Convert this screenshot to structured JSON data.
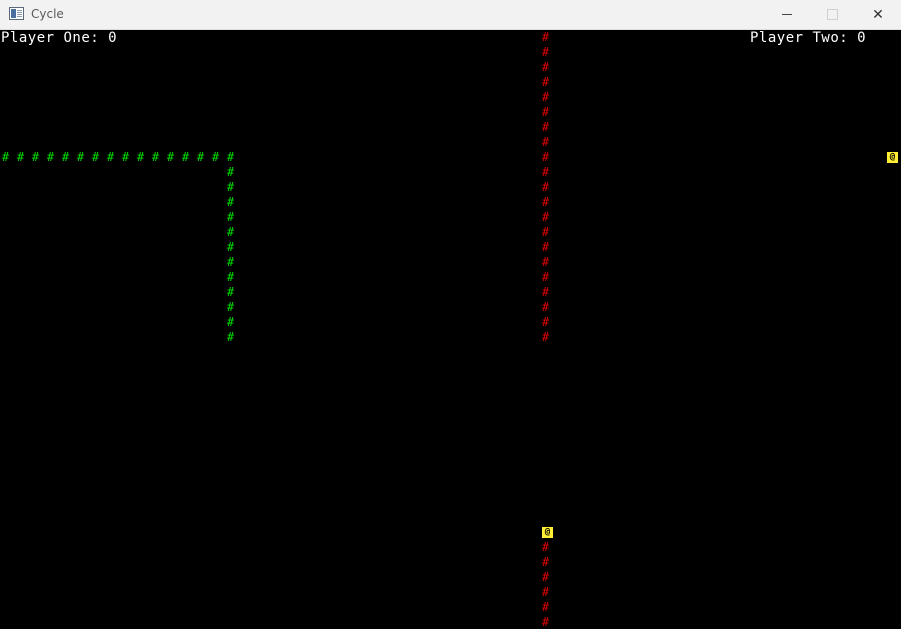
{
  "window": {
    "title": "Cycle",
    "min_symbol": "",
    "close_symbol": "✕"
  },
  "scores": {
    "player_one": "Player One: 0",
    "player_two": "Player Two: 0"
  },
  "colors": {
    "player_one_trail": "#00e000",
    "player_two_trail": "#e00000",
    "head": "#ffee33"
  },
  "game": {
    "trail_glyph": "#",
    "head_glyph": "@",
    "grid": {
      "cols": 60,
      "rows": 40
    },
    "player_one_trail": [
      [
        0,
        8
      ],
      [
        1,
        8
      ],
      [
        2,
        8
      ],
      [
        3,
        8
      ],
      [
        4,
        8
      ],
      [
        5,
        8
      ],
      [
        6,
        8
      ],
      [
        7,
        8
      ],
      [
        8,
        8
      ],
      [
        9,
        8
      ],
      [
        10,
        8
      ],
      [
        11,
        8
      ],
      [
        12,
        8
      ],
      [
        13,
        8
      ],
      [
        14,
        8
      ],
      [
        15,
        8
      ],
      [
        15,
        9
      ],
      [
        15,
        10
      ],
      [
        15,
        11
      ],
      [
        15,
        12
      ],
      [
        15,
        13
      ],
      [
        15,
        14
      ],
      [
        15,
        15
      ],
      [
        15,
        16
      ],
      [
        15,
        17
      ],
      [
        15,
        18
      ],
      [
        15,
        19
      ],
      [
        15,
        20
      ]
    ],
    "player_two_trail": [
      [
        36,
        0
      ],
      [
        36,
        1
      ],
      [
        36,
        2
      ],
      [
        36,
        3
      ],
      [
        36,
        4
      ],
      [
        36,
        5
      ],
      [
        36,
        6
      ],
      [
        36,
        7
      ],
      [
        36,
        8
      ],
      [
        36,
        9
      ],
      [
        36,
        10
      ],
      [
        36,
        11
      ],
      [
        36,
        12
      ],
      [
        36,
        13
      ],
      [
        36,
        14
      ],
      [
        36,
        15
      ],
      [
        36,
        16
      ],
      [
        36,
        17
      ],
      [
        36,
        18
      ],
      [
        36,
        19
      ],
      [
        36,
        20
      ],
      [
        36,
        34
      ],
      [
        36,
        35
      ],
      [
        36,
        36
      ],
      [
        36,
        37
      ],
      [
        36,
        38
      ],
      [
        36,
        39
      ]
    ],
    "heads": [
      {
        "player": "one",
        "cell": [
          59,
          8
        ]
      },
      {
        "player": "two",
        "cell": [
          36,
          33
        ]
      }
    ]
  }
}
